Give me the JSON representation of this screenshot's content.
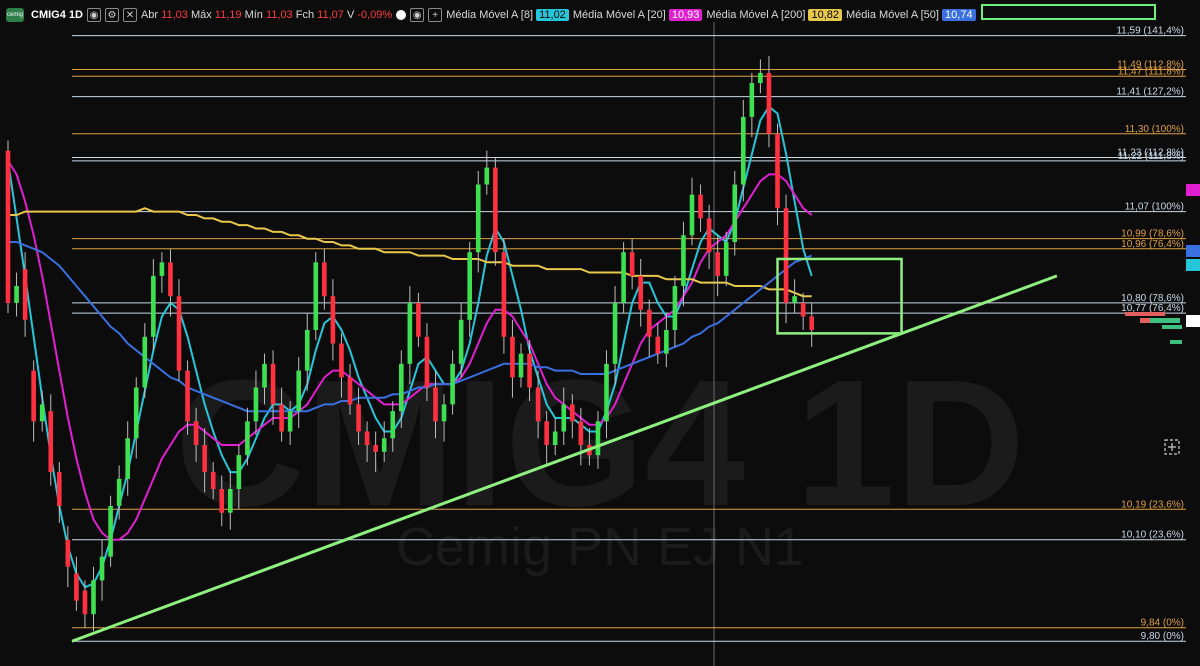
{
  "header": {
    "symbol": "CMIG4 1D",
    "ohlc": {
      "abr_label": "Abr",
      "abr": "11,03",
      "max_label": "Máx",
      "max": "11,19",
      "min_label": "Mín",
      "min": "11,03",
      "fch_label": "Fch",
      "fch": "11,07",
      "v_label": "V",
      "var": "-0,09%"
    },
    "indicators": [
      {
        "label": "Média Móvel A [8]",
        "value": "11,02",
        "color": "#26c6da"
      },
      {
        "label": "Média Móvel A [20]",
        "value": "10,93",
        "color": "#e020d0"
      },
      {
        "label": "Média Móvel A [200]",
        "value": "10,82",
        "color": "#e8c84a"
      },
      {
        "label": "Média Móvel A [50]",
        "value": "10,74",
        "color": "#3a6fe0"
      }
    ]
  },
  "watermark": {
    "title": "CMIG4 1D",
    "subtitle": "Cemig PN EJ N1"
  },
  "chart_data": {
    "type": "candlestick",
    "title": "CMIG4 1D",
    "ylim": [
      9.78,
      11.66
    ],
    "candles": [
      [
        11.25,
        10.8
      ],
      [
        10.8,
        10.85
      ],
      [
        10.9,
        10.75
      ],
      [
        10.6,
        10.45
      ],
      [
        10.45,
        10.5
      ],
      [
        10.48,
        10.3
      ],
      [
        10.3,
        10.2
      ],
      [
        10.1,
        10.02
      ],
      [
        10.0,
        9.92
      ],
      [
        9.95,
        9.88
      ],
      [
        9.88,
        9.98
      ],
      [
        9.98,
        10.05
      ],
      [
        10.05,
        10.2
      ],
      [
        10.2,
        10.28
      ],
      [
        10.28,
        10.4
      ],
      [
        10.4,
        10.55
      ],
      [
        10.55,
        10.7
      ],
      [
        10.7,
        10.88
      ],
      [
        10.88,
        10.92
      ],
      [
        10.92,
        10.82
      ],
      [
        10.82,
        10.6
      ],
      [
        10.6,
        10.45
      ],
      [
        10.45,
        10.38
      ],
      [
        10.38,
        10.3
      ],
      [
        10.3,
        10.25
      ],
      [
        10.25,
        10.18
      ],
      [
        10.18,
        10.25
      ],
      [
        10.25,
        10.35
      ],
      [
        10.35,
        10.45
      ],
      [
        10.45,
        10.55
      ],
      [
        10.55,
        10.62
      ],
      [
        10.62,
        10.5
      ],
      [
        10.5,
        10.42
      ],
      [
        10.42,
        10.48
      ],
      [
        10.48,
        10.6
      ],
      [
        10.6,
        10.72
      ],
      [
        10.72,
        10.92
      ],
      [
        10.92,
        10.82
      ],
      [
        10.82,
        10.68
      ],
      [
        10.68,
        10.58
      ],
      [
        10.58,
        10.5
      ],
      [
        10.5,
        10.42
      ],
      [
        10.42,
        10.38
      ],
      [
        10.38,
        10.36
      ],
      [
        10.36,
        10.4
      ],
      [
        10.4,
        10.48
      ],
      [
        10.48,
        10.62
      ],
      [
        10.62,
        10.8
      ],
      [
        10.8,
        10.7
      ],
      [
        10.7,
        10.55
      ],
      [
        10.55,
        10.45
      ],
      [
        10.45,
        10.5
      ],
      [
        10.5,
        10.62
      ],
      [
        10.62,
        10.75
      ],
      [
        10.75,
        10.95
      ],
      [
        10.95,
        11.15
      ],
      [
        11.15,
        11.2
      ],
      [
        11.2,
        10.95
      ],
      [
        10.95,
        10.7
      ],
      [
        10.7,
        10.58
      ],
      [
        10.58,
        10.65
      ],
      [
        10.65,
        10.55
      ],
      [
        10.55,
        10.45
      ],
      [
        10.45,
        10.38
      ],
      [
        10.38,
        10.42
      ],
      [
        10.42,
        10.5
      ],
      [
        10.5,
        10.45
      ],
      [
        10.45,
        10.38
      ],
      [
        10.38,
        10.35
      ],
      [
        10.35,
        10.45
      ],
      [
        10.45,
        10.62
      ],
      [
        10.62,
        10.8
      ],
      [
        10.8,
        10.95
      ],
      [
        10.95,
        10.88
      ],
      [
        10.88,
        10.78
      ],
      [
        10.78,
        10.7
      ],
      [
        10.7,
        10.65
      ],
      [
        10.65,
        10.72
      ],
      [
        10.72,
        10.85
      ],
      [
        10.85,
        11.0
      ],
      [
        11.0,
        11.12
      ],
      [
        11.12,
        11.05
      ],
      [
        11.05,
        10.95
      ],
      [
        10.95,
        10.88
      ],
      [
        10.88,
        10.98
      ],
      [
        10.98,
        11.15
      ],
      [
        11.15,
        11.35
      ],
      [
        11.35,
        11.45
      ],
      [
        11.45,
        11.48
      ],
      [
        11.48,
        11.3
      ],
      [
        11.3,
        11.08
      ],
      [
        11.08,
        10.8
      ],
      [
        10.8,
        10.82
      ],
      [
        10.8,
        10.76
      ],
      [
        10.76,
        10.72
      ]
    ],
    "series": [
      {
        "name": "Média Móvel A [8]",
        "color": "#26c6da",
        "values": [
          11.22,
          11.05,
          10.88,
          10.7,
          10.52,
          10.35,
          10.2,
          10.08,
          10.0,
          9.96,
          9.97,
          10.02,
          10.1,
          10.2,
          10.3,
          10.42,
          10.54,
          10.66,
          10.76,
          10.8,
          10.78,
          10.7,
          10.6,
          10.5,
          10.42,
          10.35,
          10.3,
          10.3,
          10.34,
          10.4,
          10.46,
          10.5,
          10.5,
          10.48,
          10.5,
          10.56,
          10.66,
          10.74,
          10.76,
          10.72,
          10.66,
          10.58,
          10.52,
          10.46,
          10.42,
          10.42,
          10.46,
          10.54,
          10.62,
          10.64,
          10.6,
          10.56,
          10.56,
          10.6,
          10.68,
          10.8,
          10.94,
          11.02,
          10.98,
          10.88,
          10.78,
          10.66,
          10.58,
          10.5,
          10.46,
          10.46,
          10.46,
          10.44,
          10.42,
          10.42,
          10.48,
          10.56,
          10.68,
          10.8,
          10.86,
          10.86,
          10.8,
          10.76,
          10.76,
          10.82,
          10.9,
          10.98,
          11.02,
          11.0,
          10.98,
          11.04,
          11.14,
          11.24,
          11.34,
          11.38,
          11.36,
          11.24,
          11.1,
          10.96,
          10.88
        ]
      },
      {
        "name": "Média Móvel A [20]",
        "color": "#e020d0",
        "values": [
          11.22,
          11.18,
          11.1,
          11.0,
          10.88,
          10.74,
          10.6,
          10.46,
          10.34,
          10.24,
          10.16,
          10.12,
          10.1,
          10.1,
          10.12,
          10.16,
          10.22,
          10.28,
          10.34,
          10.38,
          10.42,
          10.44,
          10.44,
          10.42,
          10.4,
          10.38,
          10.38,
          10.38,
          10.4,
          10.42,
          10.44,
          10.46,
          10.46,
          10.46,
          10.48,
          10.5,
          10.54,
          10.58,
          10.6,
          10.6,
          10.58,
          10.56,
          10.54,
          10.52,
          10.5,
          10.5,
          10.5,
          10.52,
          10.54,
          10.56,
          10.56,
          10.56,
          10.56,
          10.58,
          10.62,
          10.68,
          10.74,
          10.78,
          10.78,
          10.76,
          10.72,
          10.68,
          10.62,
          10.56,
          10.52,
          10.5,
          10.48,
          10.46,
          10.44,
          10.44,
          10.46,
          10.5,
          10.56,
          10.62,
          10.68,
          10.72,
          10.74,
          10.76,
          10.78,
          10.82,
          10.86,
          10.92,
          10.96,
          10.98,
          11.0,
          11.04,
          11.08,
          11.12,
          11.16,
          11.18,
          11.18,
          11.16,
          11.12,
          11.08,
          11.06
        ]
      },
      {
        "name": "Média Móvel A [200]",
        "color": "#e8c84a",
        "values": [
          11.06,
          11.06,
          11.07,
          11.07,
          11.07,
          11.07,
          11.07,
          11.07,
          11.07,
          11.07,
          11.07,
          11.07,
          11.07,
          11.07,
          11.07,
          11.07,
          11.08,
          11.07,
          11.07,
          11.07,
          11.07,
          11.06,
          11.06,
          11.05,
          11.05,
          11.04,
          11.04,
          11.03,
          11.03,
          11.02,
          11.02,
          11.01,
          11.01,
          11.0,
          11.0,
          10.99,
          10.99,
          10.98,
          10.98,
          10.97,
          10.97,
          10.96,
          10.96,
          10.96,
          10.95,
          10.95,
          10.95,
          10.95,
          10.94,
          10.94,
          10.94,
          10.94,
          10.93,
          10.93,
          10.93,
          10.93,
          10.92,
          10.92,
          10.92,
          10.91,
          10.91,
          10.91,
          10.91,
          10.9,
          10.9,
          10.9,
          10.9,
          10.9,
          10.89,
          10.89,
          10.89,
          10.89,
          10.89,
          10.88,
          10.88,
          10.88,
          10.88,
          10.87,
          10.87,
          10.87,
          10.87,
          10.86,
          10.86,
          10.86,
          10.86,
          10.85,
          10.85,
          10.85,
          10.85,
          10.84,
          10.84,
          10.84,
          10.83,
          10.82,
          10.82
        ]
      },
      {
        "name": "Média Móvel A [50]",
        "color": "#3a6fe0",
        "values": [
          10.98,
          10.98,
          10.97,
          10.96,
          10.95,
          10.93,
          10.91,
          10.88,
          10.85,
          10.82,
          10.79,
          10.76,
          10.73,
          10.71,
          10.68,
          10.66,
          10.64,
          10.62,
          10.6,
          10.58,
          10.57,
          10.55,
          10.54,
          10.53,
          10.52,
          10.51,
          10.5,
          10.49,
          10.48,
          10.48,
          10.48,
          10.48,
          10.48,
          10.48,
          10.48,
          10.48,
          10.49,
          10.5,
          10.5,
          10.51,
          10.51,
          10.52,
          10.52,
          10.52,
          10.52,
          10.53,
          10.53,
          10.54,
          10.55,
          10.55,
          10.56,
          10.56,
          10.56,
          10.57,
          10.58,
          10.59,
          10.6,
          10.61,
          10.62,
          10.62,
          10.62,
          10.62,
          10.61,
          10.61,
          10.6,
          10.6,
          10.6,
          10.59,
          10.59,
          10.59,
          10.59,
          10.6,
          10.61,
          10.62,
          10.63,
          10.64,
          10.65,
          10.66,
          10.67,
          10.68,
          10.7,
          10.71,
          10.73,
          10.74,
          10.76,
          10.78,
          10.8,
          10.82,
          10.84,
          10.86,
          10.88,
          10.9,
          10.92,
          10.93,
          10.94
        ]
      }
    ],
    "levels": [
      {
        "label": "11,59 (141,4%)",
        "value": 11.59,
        "color": "#c8d8e8"
      },
      {
        "label": "11,49 (112,8%)",
        "value": 11.49,
        "color": "#e0a040"
      },
      {
        "label": "11,47 (111,8%)",
        "value": 11.47,
        "color": "#e0a040"
      },
      {
        "label": "11,41 (127,2%)",
        "value": 11.41,
        "color": "#c8d8e8"
      },
      {
        "label": "11,30 (100%)",
        "value": 11.3,
        "color": "#e0a040"
      },
      {
        "label": "11,23 (112,8%)",
        "value": 11.23,
        "color": "#c8d8e8"
      },
      {
        "label": "11,22 (111,8%)",
        "value": 11.22,
        "color": "#c8d8e8"
      },
      {
        "label": "11,07 (100%)",
        "value": 11.07,
        "color": "#c8d8e8"
      },
      {
        "label": "10,99 (78,6%)",
        "value": 10.99,
        "color": "#e0a040"
      },
      {
        "label": "10,96 (76,4%)",
        "value": 10.96,
        "color": "#e0a040"
      },
      {
        "label": "10,80 (78,6%)",
        "value": 10.8,
        "color": "#c8d8e8"
      },
      {
        "label": "10,77 (76,4%)",
        "value": 10.77,
        "color": "#c8d8e8"
      },
      {
        "label": "10,19 (23,6%)",
        "value": 10.19,
        "color": "#e0a040"
      },
      {
        "label": "10,10 (23,6%)",
        "value": 10.1,
        "color": "#c8d8e8"
      },
      {
        "label": "9,84 (0%)",
        "value": 9.84,
        "color": "#e0a040"
      },
      {
        "label": "9,80 (0%)",
        "value": 9.8,
        "color": "#c8d8e8"
      }
    ],
    "trendline": {
      "from": [
        0,
        9.8
      ],
      "to": [
        118,
        10.88
      ],
      "color": "#8ef07e"
    },
    "highlight_box": {
      "x_range": [
        90,
        101
      ],
      "y_range": [
        10.71,
        10.93
      ],
      "color": "#8ef07e"
    },
    "grid": false
  }
}
